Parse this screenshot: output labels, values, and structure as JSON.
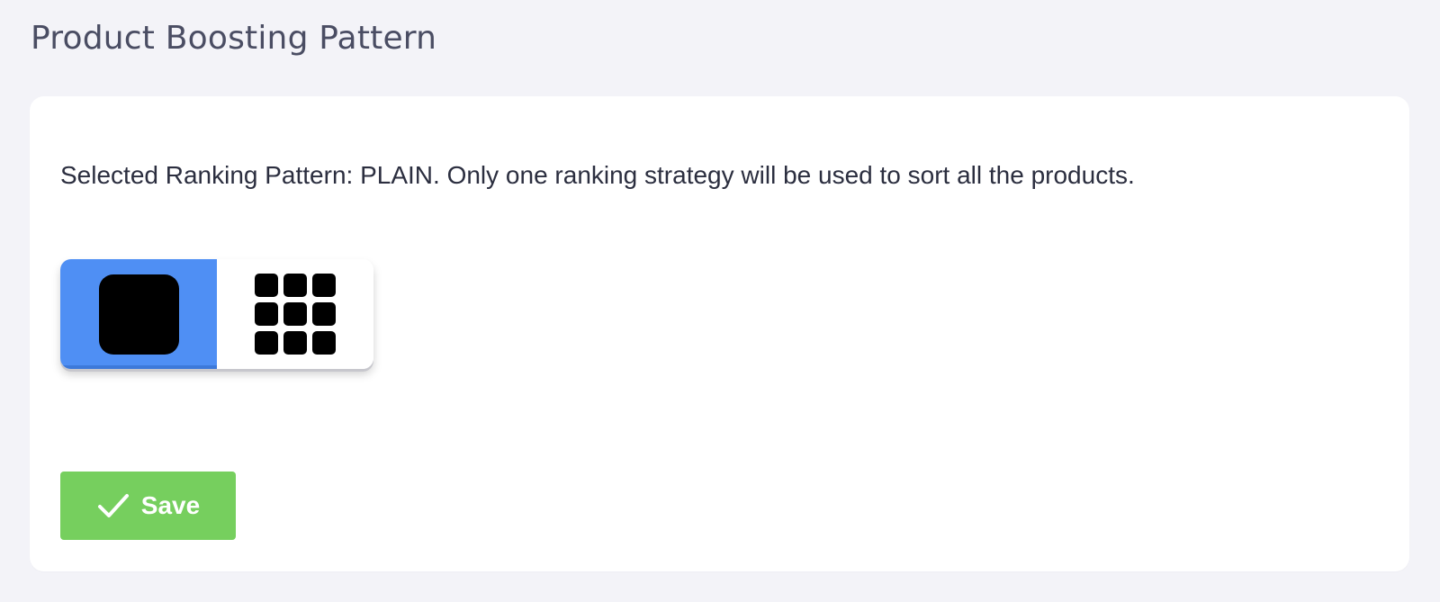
{
  "page": {
    "title": "Product Boosting Pattern"
  },
  "card": {
    "description": "Selected Ranking Pattern: PLAIN. Only one ranking strategy will be used to sort all the products.",
    "pattern_toggle": {
      "options": [
        {
          "icon": "single-square-icon",
          "selected": true
        },
        {
          "icon": "grid-3x3-icon",
          "selected": false
        }
      ]
    },
    "save_button": {
      "label": "Save",
      "icon": "check-icon"
    }
  },
  "colors": {
    "background": "#f3f3f8",
    "card": "#ffffff",
    "title": "#4a4d63",
    "text": "#2b2e3f",
    "toggle_active": "#4f8ff4",
    "save_button": "#76cf5e"
  }
}
